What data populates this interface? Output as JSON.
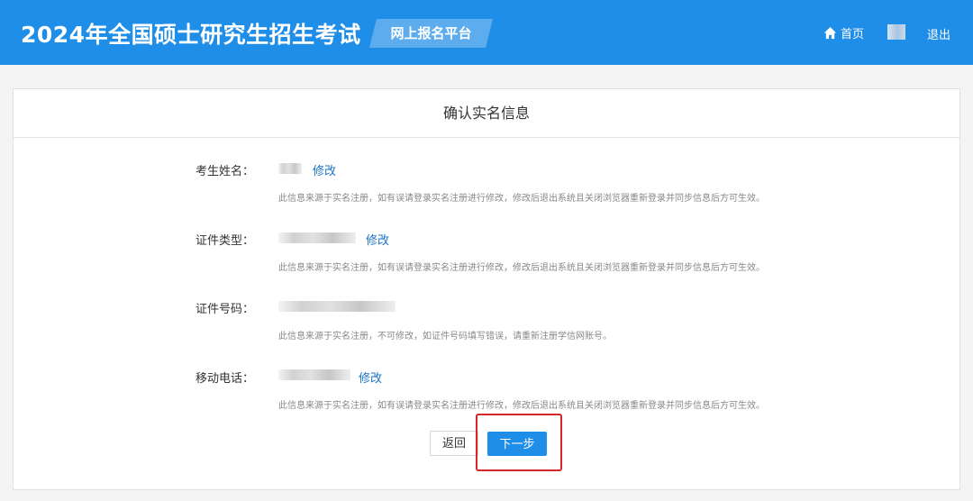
{
  "header": {
    "title": "2024年全国硕士研究生招生考试",
    "platform": "网上报名平台",
    "home_label": "首页",
    "logout_label": "退出",
    "accent_color": "#1f8ee8"
  },
  "card": {
    "title": "确认实名信息",
    "fields": [
      {
        "label": "考生姓名：",
        "edit_label": "修改",
        "hint": "此信息来源于实名注册，如有误请登录实名注册进行修改，修改后退出系统且关闭浏览器重新登录并同步信息后方可生效。"
      },
      {
        "label": "证件类型：",
        "edit_label": "修改",
        "hint": "此信息来源于实名注册，如有误请登录实名注册进行修改，修改后退出系统且关闭浏览器重新登录并同步信息后方可生效。"
      },
      {
        "label": "证件号码：",
        "hint": "此信息来源于实名注册，不可修改，如证件号码填写错误，请重新注册学信网账号。"
      },
      {
        "label": "移动电话：",
        "edit_label": "修改",
        "hint": "此信息来源于实名注册，如有误请登录实名注册进行修改，修改后退出系统且关闭浏览器重新登录并同步信息后方可生效。"
      }
    ]
  },
  "buttons": {
    "back_label": "返回",
    "next_label": "下一步"
  },
  "annotation": {
    "highlight_color": "#d9262c"
  }
}
